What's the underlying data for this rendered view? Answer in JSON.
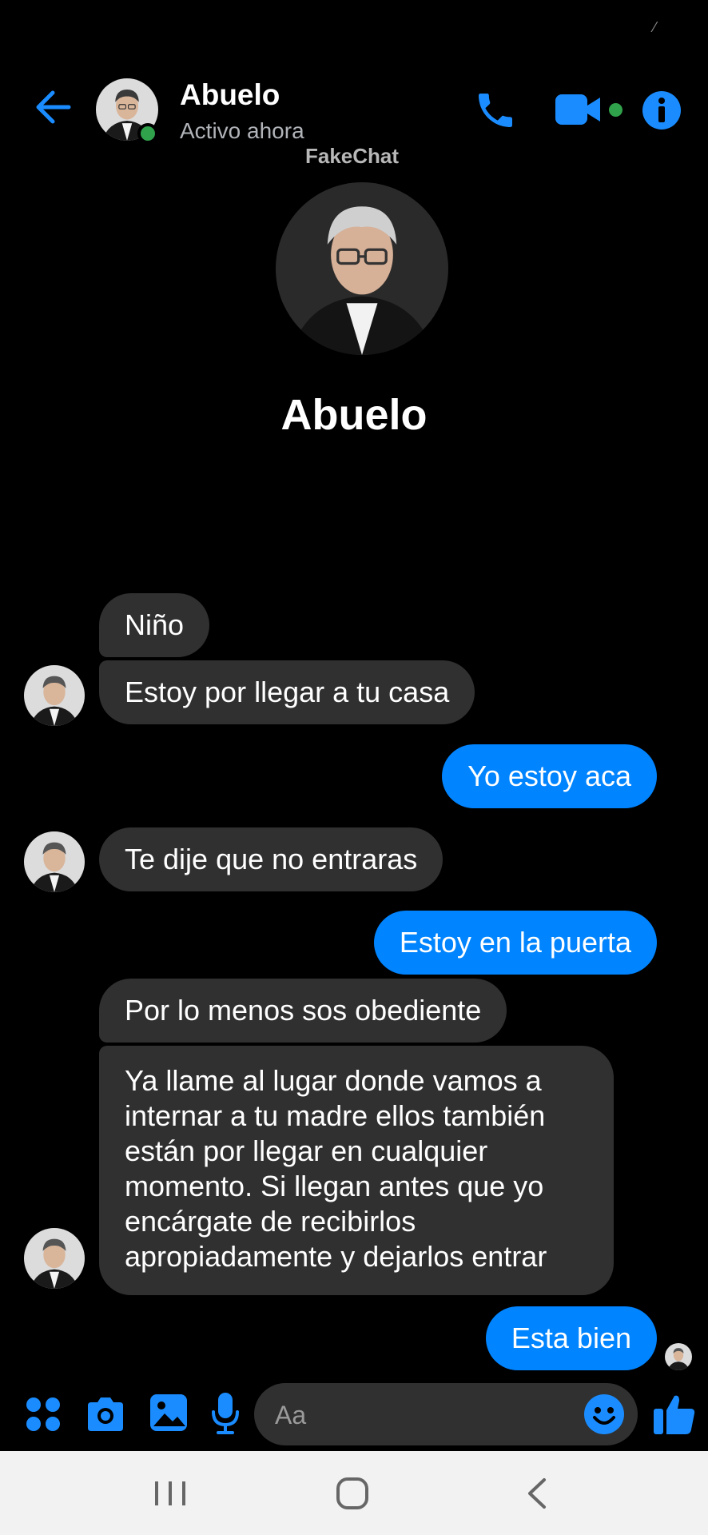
{
  "header": {
    "contact_name": "Abuelo",
    "status": "Activo ahora",
    "watermark": "FakeChat",
    "icons": [
      "back-arrow-icon",
      "phone-icon",
      "video-camera-icon",
      "info-icon"
    ]
  },
  "profile": {
    "name": "Abuelo"
  },
  "messages": [
    {
      "from": "contact",
      "text": "Niño"
    },
    {
      "from": "contact",
      "text": "Estoy por llegar a tu casa"
    },
    {
      "from": "me",
      "text": "Yo estoy aca"
    },
    {
      "from": "contact",
      "text": "Te dije que no entraras"
    },
    {
      "from": "me",
      "text": "Estoy en la puerta"
    },
    {
      "from": "contact",
      "text": "Por lo menos sos obediente"
    },
    {
      "from": "contact",
      "text": "Ya llame al lugar donde vamos a internar a tu madre ellos también están por llegar en cualquier momento. Si llegan antes que yo encárgate de recibirlos apropiadamente y dejarlos entrar"
    },
    {
      "from": "me",
      "text": "Esta bien"
    }
  ],
  "composer": {
    "placeholder": "Aa",
    "icons": [
      "apps-icon",
      "camera-icon",
      "gallery-icon",
      "microphone-icon",
      "emoji-icon",
      "thumbs-up-icon"
    ]
  },
  "colors": {
    "accent": "#0084ff",
    "incoming_bubble": "#303030",
    "online": "#31a24c",
    "background": "#000000"
  }
}
